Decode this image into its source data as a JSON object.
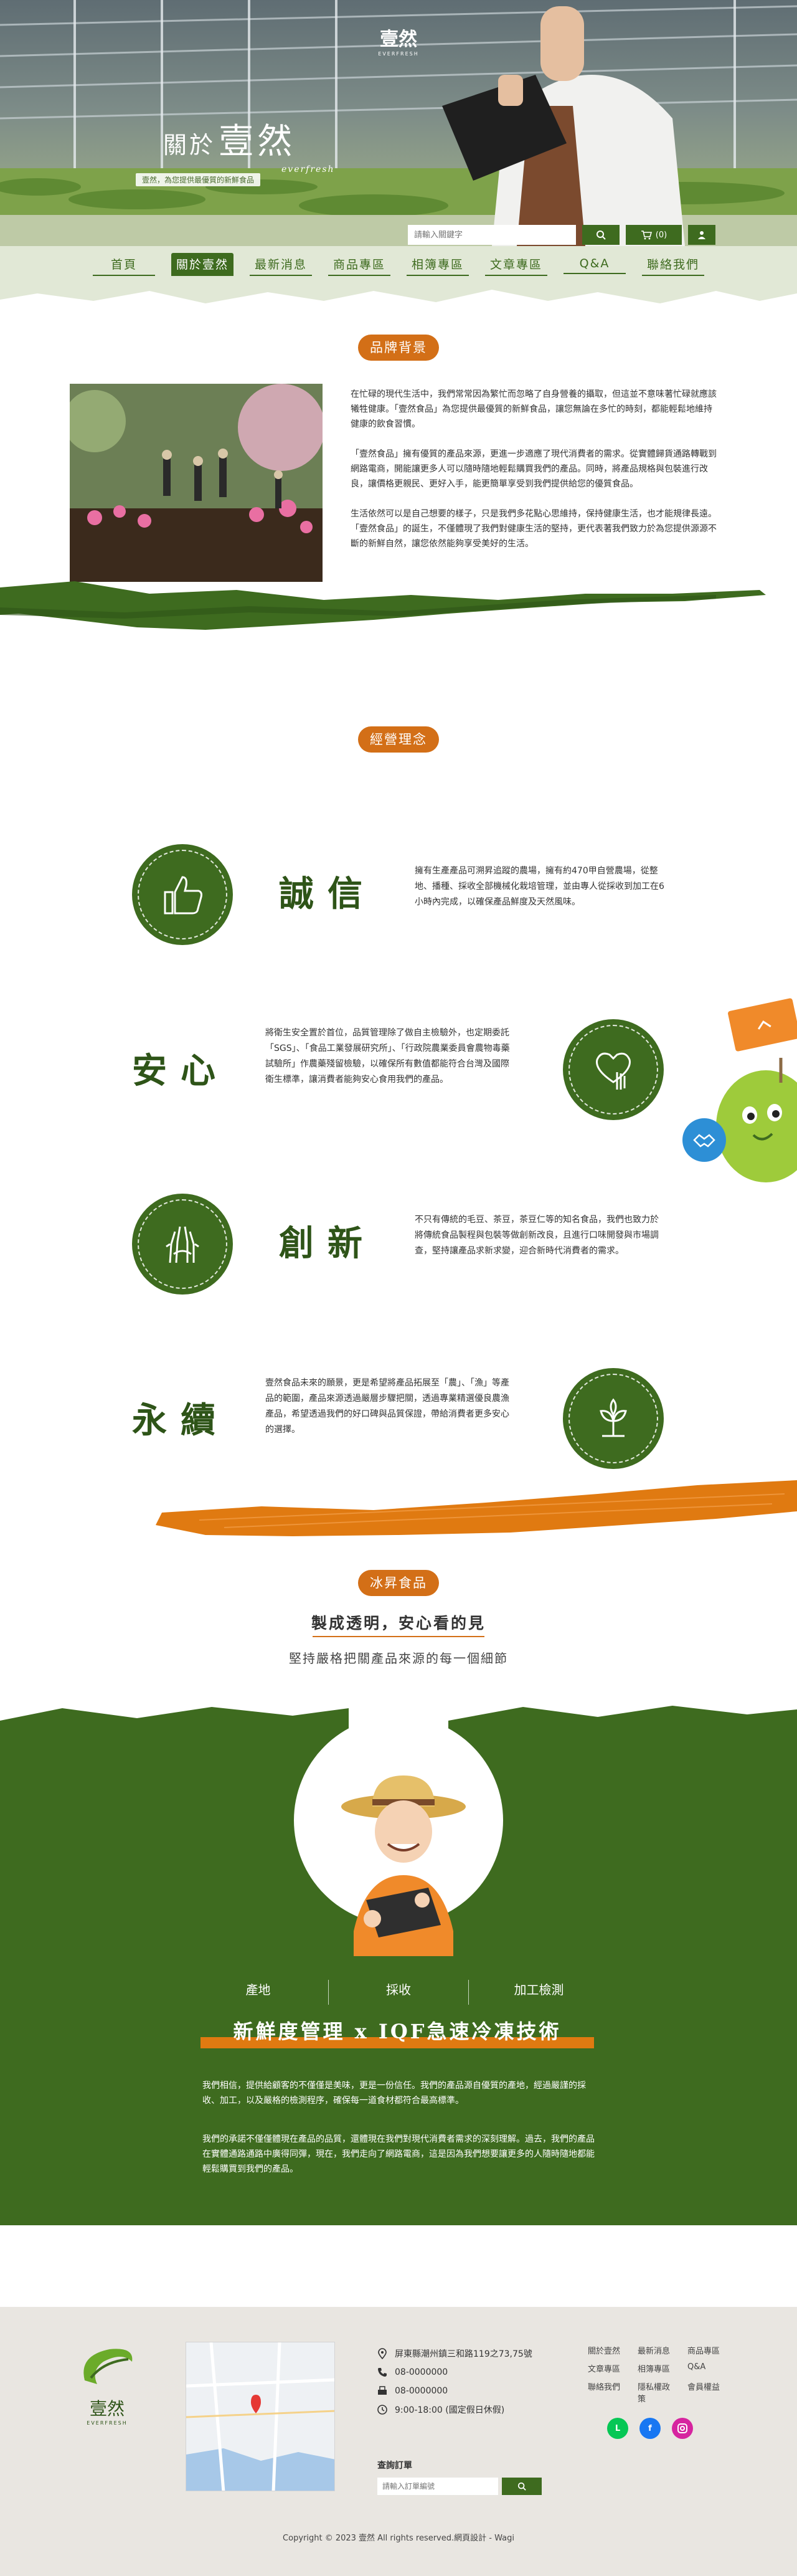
{
  "header": {
    "logo_text": "壹然",
    "logo_sub": "EVERFRESH",
    "hero_title_1": "關於",
    "hero_title_2": "壹然",
    "hero_title_en": "everfresh",
    "hero_subtitle": "壹然，為您提供最優質的新鮮食品",
    "search_placeholder": "請輸入關鍵字",
    "cart_count": "(0)",
    "accent": "#3e6b1f"
  },
  "nav": {
    "items": [
      {
        "label": "首頁"
      },
      {
        "label": "關於壹然"
      },
      {
        "label": "最新消息"
      },
      {
        "label": "商品專區"
      },
      {
        "label": "相簿專區"
      },
      {
        "label": "文章專區"
      },
      {
        "label": "Q&A"
      },
      {
        "label": "聯絡我們"
      }
    ],
    "active_index": 1
  },
  "brand": {
    "badge": "品牌背景",
    "paragraphs": [
      "在忙碌的現代生活中，我們常常因為繁忙而忽略了自身營養的攝取，但這並不意味著忙碌就應該犧牲健康。「壹然食品」為您提供最優質的新鮮食品，讓您無論在多忙的時刻，都能輕鬆地維持健康的飲食習慣。",
      "「壹然食品」擁有優質的產品來源，更進一步適應了現代消費者的需求。從實體歸貨通路轉戰到網路電商，開能讓更多人可以隨時隨地輕鬆購買我們的產品。同時，將產品規格與包裝進行改良，讓價格更親民、更好入手，能更簡單享受到我們提供給您的優質食品。",
      "生活依然可以是自己想要的樣子，只是我們多花點心思維持，保持健康生活，也才能規律長遠。「壹然食品」的誕生，不僅體現了我們對健康生活的堅持，更代表著我們致力於為您提供源源不斷的新鮮自然，讓您依然能夠享受美好的生活。"
    ]
  },
  "philosophy": {
    "badge": "經營理念",
    "pillars": [
      {
        "title": "誠信",
        "icon": "thumbs-up-icon",
        "text": "擁有生產產品可溯昇追蹤的農場，擁有約470甲自營農場，從整地、播種、採收全部機械化栽培管理，並由專人從採收到加工在6小時內完成，以確保產品鮮度及天然風味。"
      },
      {
        "title": "安心",
        "icon": "heart-hand-icon",
        "text": "將衛生安全置於首位，品質管理除了做自主檢驗外，也定期委託「SGS」、「食品工業發展研究所」、「行政院農業委員會農物毒藥試驗所」作農藥殘留檢驗，以確保所有數值都能符合台灣及國際衛生標準，讓消費者能夠安心食用我們的產品。"
      },
      {
        "title": "創新",
        "icon": "hands-idea-icon",
        "text": "不只有傳統的毛豆、茶豆，茶豆仁等的知名食品，我們也致力於將傳統食品製程與包裝等做創新改良，且進行口味開發與市場調查，堅持讓產品求新求變，迎合新時代消費者的需求。"
      },
      {
        "title": "永續",
        "icon": "leaf-icon",
        "text": "壹然食品未來的願景，更是希望將產品拓展至「農」、「漁」等產品的範圍，產品來源透過嚴層步驟把關，透過專業精選優良農漁產品，希望透過我們的好口碑與品質保證，帶給消費者更多安心的選擇。"
      }
    ]
  },
  "frozen": {
    "badge": "冰昇食品",
    "heading": "製成透明，安心看的見",
    "subheading": "堅持嚴格把關產品來源的每一個細節",
    "tabs": [
      "產地",
      "採收",
      "加工檢測"
    ],
    "iqf_title": "新鮮度管理 x IQF急速冷凍技術",
    "paragraphs": [
      "我們相信，提供給顧客的不僅僅是美味，更是一份信任。我們的產品源自優質的產地，經過嚴謹的採收、加工，以及嚴格的檢測程序，確保每一道食材都符合最高標準。",
      "我們的承諾不僅僅體現在產品的品質，還體現在我們對現代消費者需求的深刻理解。過去，我們的產品在實體通路通路中廣得同彈，現在，我們走向了網路電商，這是因為我們想要讓更多的人隨時隨地都能輕鬆購買到我們的產品。"
    ]
  },
  "footer": {
    "logo_text": "壹然",
    "logo_sub": "EVERFRESH",
    "address": "屏東縣潮州鎮三和路119之73,75號",
    "phone": "08-0000000",
    "fax": "08-0000000",
    "hours": "9:00-18:00 (國定假日休假)",
    "links": [
      "關於壹然",
      "最新消息",
      "商品專區",
      "文章專區",
      "相簿專區",
      "Q&A",
      "聯絡我們",
      "隱私權政策",
      "會員權益"
    ],
    "order_title": "查詢訂單",
    "order_placeholder": "請輸入訂單編號",
    "copyright": "Copyright © 2023 壹然 All rights reserved.網頁設計 - Wagi",
    "colors": {
      "line": "#06c755",
      "facebook": "#1877f2",
      "instagram": "#d6249f"
    }
  }
}
